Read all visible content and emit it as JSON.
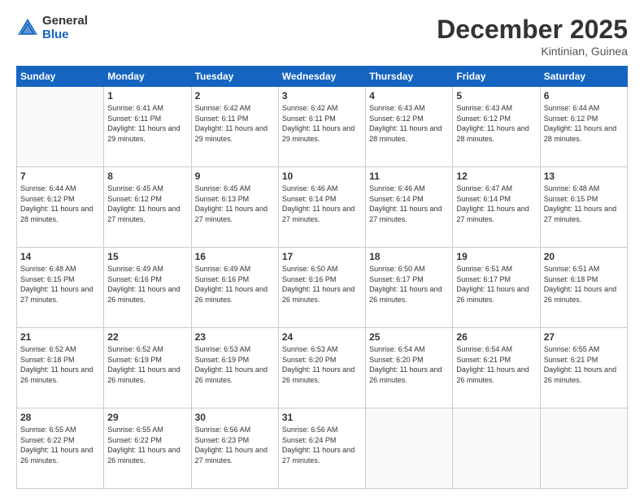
{
  "logo": {
    "general": "General",
    "blue": "Blue"
  },
  "header": {
    "month": "December 2025",
    "location": "Kintinian, Guinea"
  },
  "weekdays": [
    "Sunday",
    "Monday",
    "Tuesday",
    "Wednesday",
    "Thursday",
    "Friday",
    "Saturday"
  ],
  "weeks": [
    [
      {
        "day": "",
        "sunrise": "",
        "sunset": "",
        "daylight": ""
      },
      {
        "day": "1",
        "sunrise": "Sunrise: 6:41 AM",
        "sunset": "Sunset: 6:11 PM",
        "daylight": "Daylight: 11 hours and 29 minutes."
      },
      {
        "day": "2",
        "sunrise": "Sunrise: 6:42 AM",
        "sunset": "Sunset: 6:11 PM",
        "daylight": "Daylight: 11 hours and 29 minutes."
      },
      {
        "day": "3",
        "sunrise": "Sunrise: 6:42 AM",
        "sunset": "Sunset: 6:11 PM",
        "daylight": "Daylight: 11 hours and 29 minutes."
      },
      {
        "day": "4",
        "sunrise": "Sunrise: 6:43 AM",
        "sunset": "Sunset: 6:12 PM",
        "daylight": "Daylight: 11 hours and 28 minutes."
      },
      {
        "day": "5",
        "sunrise": "Sunrise: 6:43 AM",
        "sunset": "Sunset: 6:12 PM",
        "daylight": "Daylight: 11 hours and 28 minutes."
      },
      {
        "day": "6",
        "sunrise": "Sunrise: 6:44 AM",
        "sunset": "Sunset: 6:12 PM",
        "daylight": "Daylight: 11 hours and 28 minutes."
      }
    ],
    [
      {
        "day": "7",
        "sunrise": "Sunrise: 6:44 AM",
        "sunset": "Sunset: 6:12 PM",
        "daylight": "Daylight: 11 hours and 28 minutes."
      },
      {
        "day": "8",
        "sunrise": "Sunrise: 6:45 AM",
        "sunset": "Sunset: 6:12 PM",
        "daylight": "Daylight: 11 hours and 27 minutes."
      },
      {
        "day": "9",
        "sunrise": "Sunrise: 6:45 AM",
        "sunset": "Sunset: 6:13 PM",
        "daylight": "Daylight: 11 hours and 27 minutes."
      },
      {
        "day": "10",
        "sunrise": "Sunrise: 6:46 AM",
        "sunset": "Sunset: 6:14 PM",
        "daylight": "Daylight: 11 hours and 27 minutes."
      },
      {
        "day": "11",
        "sunrise": "Sunrise: 6:46 AM",
        "sunset": "Sunset: 6:14 PM",
        "daylight": "Daylight: 11 hours and 27 minutes."
      },
      {
        "day": "12",
        "sunrise": "Sunrise: 6:47 AM",
        "sunset": "Sunset: 6:14 PM",
        "daylight": "Daylight: 11 hours and 27 minutes."
      },
      {
        "day": "13",
        "sunrise": "Sunrise: 6:48 AM",
        "sunset": "Sunset: 6:15 PM",
        "daylight": "Daylight: 11 hours and 27 minutes."
      }
    ],
    [
      {
        "day": "14",
        "sunrise": "Sunrise: 6:48 AM",
        "sunset": "Sunset: 6:15 PM",
        "daylight": "Daylight: 11 hours and 27 minutes."
      },
      {
        "day": "15",
        "sunrise": "Sunrise: 6:49 AM",
        "sunset": "Sunset: 6:16 PM",
        "daylight": "Daylight: 11 hours and 26 minutes."
      },
      {
        "day": "16",
        "sunrise": "Sunrise: 6:49 AM",
        "sunset": "Sunset: 6:16 PM",
        "daylight": "Daylight: 11 hours and 26 minutes."
      },
      {
        "day": "17",
        "sunrise": "Sunrise: 6:50 AM",
        "sunset": "Sunset: 6:16 PM",
        "daylight": "Daylight: 11 hours and 26 minutes."
      },
      {
        "day": "18",
        "sunrise": "Sunrise: 6:50 AM",
        "sunset": "Sunset: 6:17 PM",
        "daylight": "Daylight: 11 hours and 26 minutes."
      },
      {
        "day": "19",
        "sunrise": "Sunrise: 6:51 AM",
        "sunset": "Sunset: 6:17 PM",
        "daylight": "Daylight: 11 hours and 26 minutes."
      },
      {
        "day": "20",
        "sunrise": "Sunrise: 6:51 AM",
        "sunset": "Sunset: 6:18 PM",
        "daylight": "Daylight: 11 hours and 26 minutes."
      }
    ],
    [
      {
        "day": "21",
        "sunrise": "Sunrise: 6:52 AM",
        "sunset": "Sunset: 6:18 PM",
        "daylight": "Daylight: 11 hours and 26 minutes."
      },
      {
        "day": "22",
        "sunrise": "Sunrise: 6:52 AM",
        "sunset": "Sunset: 6:19 PM",
        "daylight": "Daylight: 11 hours and 26 minutes."
      },
      {
        "day": "23",
        "sunrise": "Sunrise: 6:53 AM",
        "sunset": "Sunset: 6:19 PM",
        "daylight": "Daylight: 11 hours and 26 minutes."
      },
      {
        "day": "24",
        "sunrise": "Sunrise: 6:53 AM",
        "sunset": "Sunset: 6:20 PM",
        "daylight": "Daylight: 11 hours and 26 minutes."
      },
      {
        "day": "25",
        "sunrise": "Sunrise: 6:54 AM",
        "sunset": "Sunset: 6:20 PM",
        "daylight": "Daylight: 11 hours and 26 minutes."
      },
      {
        "day": "26",
        "sunrise": "Sunrise: 6:54 AM",
        "sunset": "Sunset: 6:21 PM",
        "daylight": "Daylight: 11 hours and 26 minutes."
      },
      {
        "day": "27",
        "sunrise": "Sunrise: 6:55 AM",
        "sunset": "Sunset: 6:21 PM",
        "daylight": "Daylight: 11 hours and 26 minutes."
      }
    ],
    [
      {
        "day": "28",
        "sunrise": "Sunrise: 6:55 AM",
        "sunset": "Sunset: 6:22 PM",
        "daylight": "Daylight: 11 hours and 26 minutes."
      },
      {
        "day": "29",
        "sunrise": "Sunrise: 6:55 AM",
        "sunset": "Sunset: 6:22 PM",
        "daylight": "Daylight: 11 hours and 26 minutes."
      },
      {
        "day": "30",
        "sunrise": "Sunrise: 6:56 AM",
        "sunset": "Sunset: 6:23 PM",
        "daylight": "Daylight: 11 hours and 27 minutes."
      },
      {
        "day": "31",
        "sunrise": "Sunrise: 6:56 AM",
        "sunset": "Sunset: 6:24 PM",
        "daylight": "Daylight: 11 hours and 27 minutes."
      },
      {
        "day": "",
        "sunrise": "",
        "sunset": "",
        "daylight": ""
      },
      {
        "day": "",
        "sunrise": "",
        "sunset": "",
        "daylight": ""
      },
      {
        "day": "",
        "sunrise": "",
        "sunset": "",
        "daylight": ""
      }
    ]
  ]
}
